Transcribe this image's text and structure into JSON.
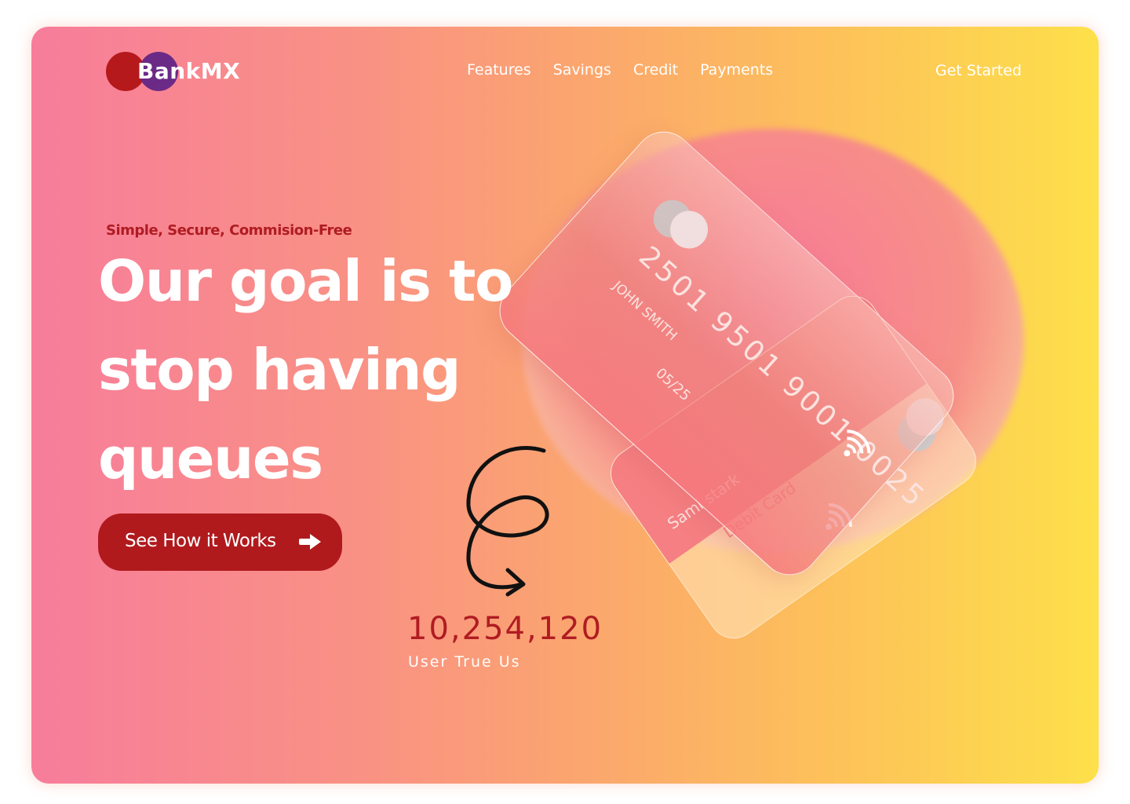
{
  "app": {
    "brand": "BankMX",
    "colors": {
      "accent_red": "#b01a1d",
      "accent_purple": "#6b2a86",
      "gradient_start": "#f77d9b",
      "gradient_end": "#fde04a"
    }
  },
  "nav": {
    "items": [
      {
        "label": "Features"
      },
      {
        "label": "Savings"
      },
      {
        "label": "Credit"
      },
      {
        "label": "Payments"
      }
    ],
    "cta_label": "Get Started"
  },
  "hero": {
    "tagline": "Simple, Secure, Commision-Free",
    "headline_lines": [
      "Our goal is to",
      "stop having",
      "queues"
    ],
    "button_label": "See How it Works",
    "button_icon": "arrow-right-icon"
  },
  "stats": {
    "count": "10,254,120",
    "label": "User True Us"
  },
  "cards": {
    "front": {
      "number": "2501 9501 9001 0025",
      "holder": "JOHN SMITH",
      "expiry": "05/25",
      "contactless_icon": "contactless-icon"
    },
    "back": {
      "holder": "Sami stark",
      "type": "Debit Card",
      "contactless_icon": "contactless-icon"
    }
  }
}
